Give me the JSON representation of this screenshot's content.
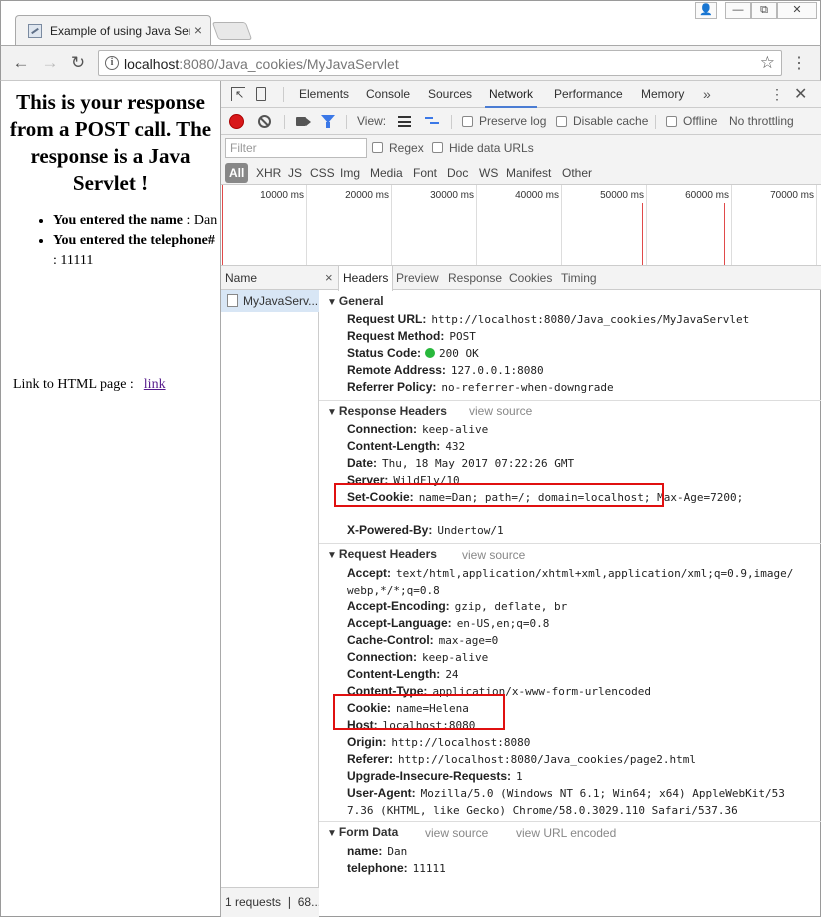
{
  "window": {
    "tab_title": "Example of using Java Serv",
    "tab_close": "×",
    "ctl_user": "👤",
    "ctl_min": "—",
    "ctl_max": "⧉",
    "ctl_close": "✕"
  },
  "toolbar": {
    "url_host": "localhost",
    "url_rest": ":8080/Java_cookies/MyJavaServlet",
    "back_icon": "←",
    "forward_icon": "→",
    "reload_icon": "↻",
    "star_icon": "☆",
    "menu_icon": "⋮"
  },
  "page": {
    "heading": "This is your response from a POST call. The response is a Java Servlet !",
    "items": [
      {
        "label": "You entered the name",
        "sep": " : ",
        "value": "Dan"
      },
      {
        "label": "You entered the telephone#",
        "sep": " : ",
        "value": "11111"
      }
    ],
    "link_prefix": "Link to HTML page :",
    "link_text": "link"
  },
  "devtools": {
    "tabs": [
      "Elements",
      "Console",
      "Sources",
      "Network",
      "Performance",
      "Memory"
    ],
    "active_tab": "Network",
    "more": "»",
    "kebab": "⋮",
    "close": "✕",
    "toolbar": {
      "view_label": "View:",
      "preserve_log": "Preserve log",
      "disable_cache": "Disable cache",
      "offline": "Offline",
      "throttling": "No throttling"
    },
    "filter_placeholder": "Filter",
    "regex": "Regex",
    "hide_data_urls": "Hide data URLs",
    "types": [
      "All",
      "XHR",
      "JS",
      "CSS",
      "Img",
      "Media",
      "Font",
      "Doc",
      "WS",
      "Manifest",
      "Other"
    ],
    "overview_ticks": [
      "10000 ms",
      "20000 ms",
      "30000 ms",
      "40000 ms",
      "50000 ms",
      "60000 ms",
      "70000 ms"
    ],
    "request_list": {
      "header": "Name",
      "rows": [
        "MyJavaServ..."
      ],
      "footer": "1 requests ❘ 68..."
    },
    "detail_tabs": [
      "Headers",
      "Preview",
      "Response",
      "Cookies",
      "Timing"
    ],
    "active_detail_tab": "Headers",
    "detail_close": "×",
    "general": {
      "title": "General",
      "rows": [
        {
          "k": "Request URL:",
          "v": "http://localhost:8080/Java_cookies/MyJavaServlet"
        },
        {
          "k": "Request Method:",
          "v": "POST"
        },
        {
          "k": "Status Code:",
          "v": "200 OK"
        },
        {
          "k": "Remote Address:",
          "v": "127.0.0.1:8080"
        },
        {
          "k": "Referrer Policy:",
          "v": "no-referrer-when-downgrade"
        }
      ]
    },
    "response_headers": {
      "title": "Response Headers",
      "view_source": "view source",
      "rows": [
        {
          "k": "Connection:",
          "v": "keep-alive"
        },
        {
          "k": "Content-Length:",
          "v": "432"
        },
        {
          "k": "Date:",
          "v": "Thu, 18 May 2017 07:22:26 GMT"
        },
        {
          "k": "Server:",
          "v": "WildFly/10"
        },
        {
          "k": "Set-Cookie:",
          "v": "name=Dan; path=/; domain=localhost; Max-Age=7200;"
        },
        {
          "k": "X-Powered-By:",
          "v": "Undertow/1"
        }
      ]
    },
    "request_headers": {
      "title": "Request Headers",
      "view_source": "view source",
      "accept_k": "Accept:",
      "accept_v1": "text/html,application/xhtml+xml,application/xml;q=0.9,image/",
      "accept_v2": "webp,*/*;q=0.8",
      "rows": [
        {
          "k": "Accept-Encoding:",
          "v": "gzip, deflate, br"
        },
        {
          "k": "Accept-Language:",
          "v": "en-US,en;q=0.8"
        },
        {
          "k": "Cache-Control:",
          "v": "max-age=0"
        },
        {
          "k": "Connection:",
          "v": "keep-alive"
        },
        {
          "k": "Content-Length:",
          "v": "24"
        },
        {
          "k": "Content-Type:",
          "v": "application/x-www-form-urlencoded"
        },
        {
          "k": "Cookie:",
          "v": "name=Helena"
        },
        {
          "k": "Host:",
          "v": "localhost:8080"
        },
        {
          "k": "Origin:",
          "v": "http://localhost:8080"
        },
        {
          "k": "Referer:",
          "v": "http://localhost:8080/Java_cookies/page2.html"
        },
        {
          "k": "Upgrade-Insecure-Requests:",
          "v": "1"
        }
      ],
      "ua_k": "User-Agent:",
      "ua_v1": "Mozilla/5.0 (Windows NT 6.1; Win64; x64) AppleWebKit/53",
      "ua_v2": "7.36 (KHTML, like Gecko) Chrome/58.0.3029.110 Safari/537.36"
    },
    "form_data": {
      "title": "Form Data",
      "view_source": "view source",
      "view_url_encoded": "view URL encoded",
      "rows": [
        {
          "k": "name:",
          "v": "Dan"
        },
        {
          "k": "telephone:",
          "v": "11111"
        }
      ]
    }
  }
}
